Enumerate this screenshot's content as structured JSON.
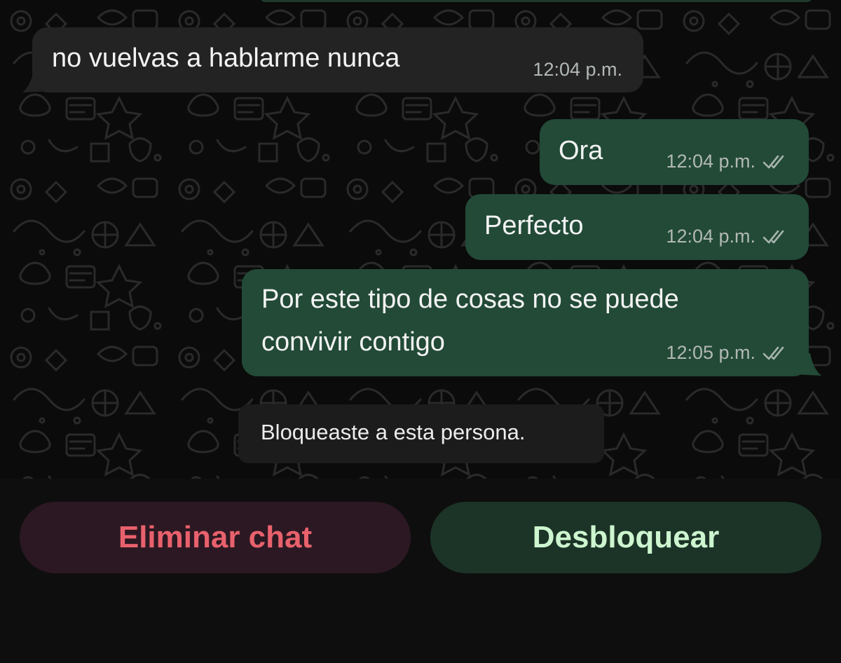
{
  "messages": [
    {
      "direction": "in",
      "text": "no vuelvas a hablarme nunca",
      "time": "12:04 p.m."
    },
    {
      "direction": "out",
      "text": "Ora",
      "time": "12:04 p.m.",
      "status": "read-double-check-icon"
    },
    {
      "direction": "out",
      "text": "Perfecto",
      "time": "12:04 p.m.",
      "status": "read-double-check-icon"
    },
    {
      "direction": "out",
      "text_line1": "Por este tipo de cosas no se puede",
      "text_line2": "convivir contigo",
      "time": "12:05 p.m.",
      "status": "read-double-check-icon"
    }
  ],
  "system_notice": "Bloqueaste a esta persona.",
  "actions": {
    "delete_label": "Eliminar chat",
    "unblock_label": "Desbloquear"
  },
  "colors": {
    "background": "#0b0b0b",
    "incoming_bubble": "#232323",
    "outgoing_bubble": "#224a37",
    "delete_text": "#e8616c",
    "unblock_text": "#cdf5cf"
  }
}
